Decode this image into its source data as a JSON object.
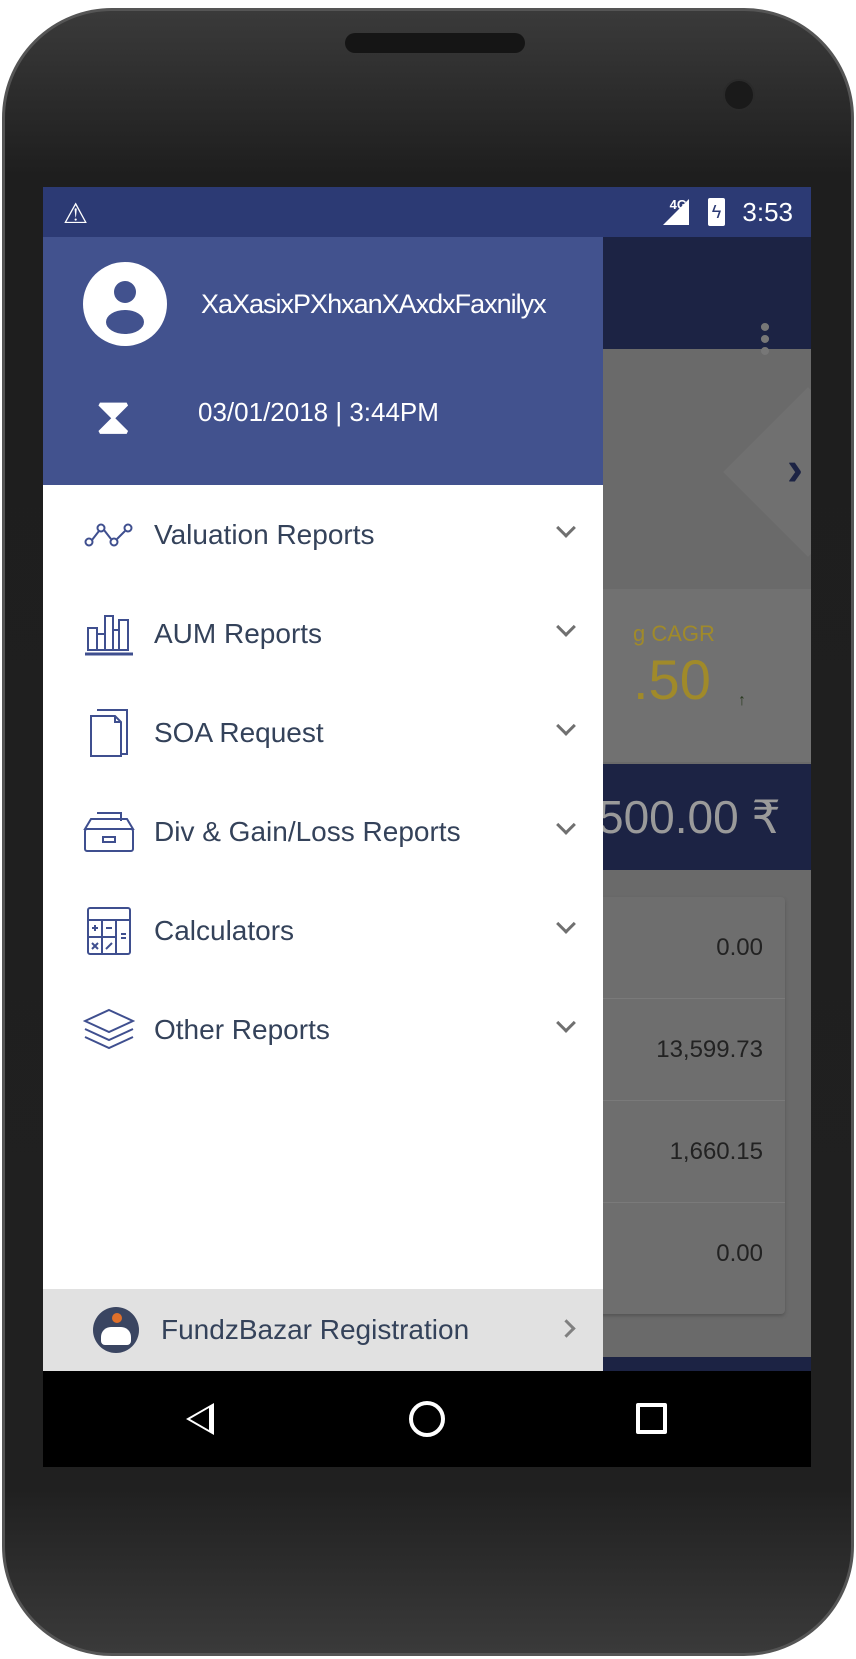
{
  "status_bar": {
    "time": "3:53",
    "network": "4G",
    "warning_icon": "warning-icon",
    "battery_icon": "battery-charging-icon"
  },
  "background": {
    "cagr_label": "g CAGR",
    "cagr_value": ".50",
    "total_value": "500.00 ₹",
    "rows": [
      "0.00",
      "13,599.73",
      "1,660.15",
      "0.00"
    ]
  },
  "drawer": {
    "user_name": "XaXasixPXhxanXAxdxFaxnilyx",
    "last_login": "03/01/2018 | 3:44PM",
    "items": [
      {
        "label": "Valuation Reports",
        "icon": "line-chart-icon"
      },
      {
        "label": "AUM Reports",
        "icon": "bar-chart-icon"
      },
      {
        "label": "SOA Request",
        "icon": "documents-icon"
      },
      {
        "label": "Div & Gain/Loss Reports",
        "icon": "file-tray-icon"
      },
      {
        "label": "Calculators",
        "icon": "calculator-icon"
      },
      {
        "label": "Other Reports",
        "icon": "layers-icon"
      }
    ],
    "registration": {
      "label": "FundzBazar Registration",
      "icon": "fundzbazar-logo"
    }
  },
  "colors": {
    "header": "#42528e",
    "status_bar": "#2c3a74",
    "text": "#34425a",
    "icon": "#3f4f8f"
  }
}
